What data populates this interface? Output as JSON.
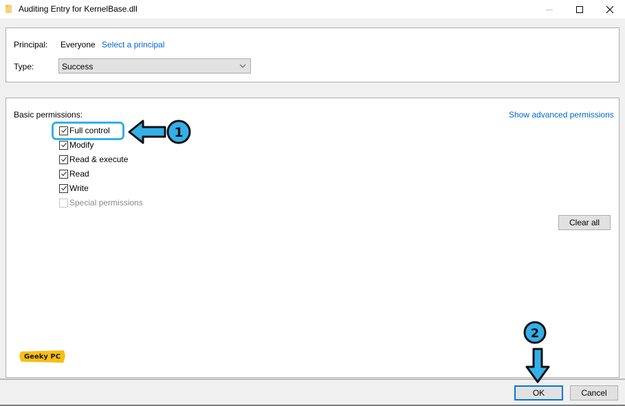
{
  "window": {
    "title": "Auditing Entry for KernelBase.dll",
    "icon": "folder-icon",
    "controls": [
      "minimize-icon",
      "maximize-icon",
      "close-icon"
    ]
  },
  "principal": {
    "label": "Principal:",
    "value": "Everyone",
    "select_link": "Select a principal"
  },
  "type": {
    "label": "Type:",
    "selected": "Success"
  },
  "permissions": {
    "heading": "Basic permissions:",
    "advanced_link": "Show advanced permissions",
    "items": [
      {
        "label": "Full control",
        "checked": true,
        "enabled": true
      },
      {
        "label": "Modify",
        "checked": true,
        "enabled": true
      },
      {
        "label": "Read & execute",
        "checked": true,
        "enabled": true
      },
      {
        "label": "Read",
        "checked": true,
        "enabled": true
      },
      {
        "label": "Write",
        "checked": true,
        "enabled": true
      },
      {
        "label": "Special permissions",
        "checked": false,
        "enabled": false
      }
    ],
    "clear_all_label": "Clear all"
  },
  "footer": {
    "ok_label": "OK",
    "cancel_label": "Cancel"
  },
  "annotations": {
    "step1": "1",
    "step2": "2",
    "accent_color": "#33b0e8"
  },
  "watermark": {
    "text": "Geeky PC",
    "color": "#f7be16"
  }
}
